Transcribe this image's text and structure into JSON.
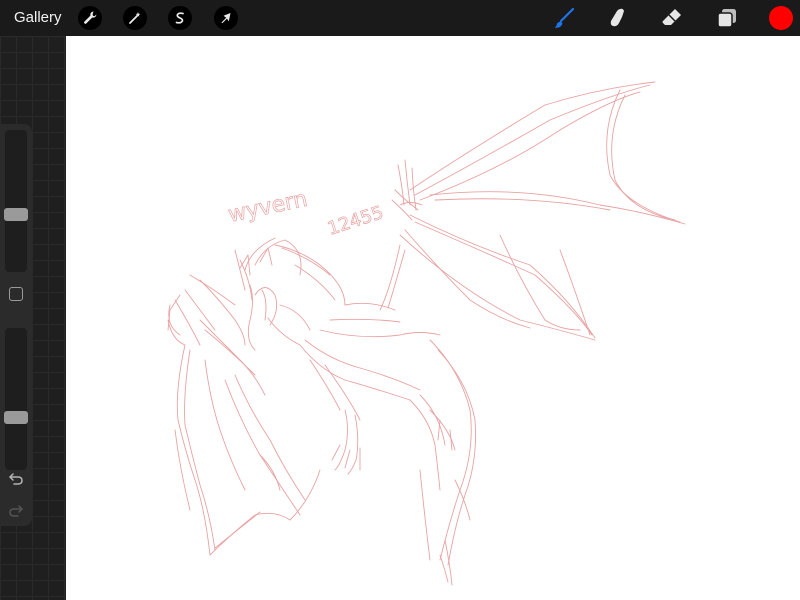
{
  "topbar": {
    "gallery_label": "Gallery",
    "tools": [
      {
        "name": "actions",
        "icon": "wrench-icon"
      },
      {
        "name": "adjustments",
        "icon": "magic-wand-icon"
      },
      {
        "name": "selection",
        "icon": "selection-s-icon"
      },
      {
        "name": "transform",
        "icon": "arrow-cursor-icon"
      }
    ],
    "right_tools": [
      {
        "name": "brush",
        "icon": "brush-icon",
        "active": true
      },
      {
        "name": "smudge",
        "icon": "smudge-finger-icon"
      },
      {
        "name": "eraser",
        "icon": "eraser-icon"
      },
      {
        "name": "layers",
        "icon": "layers-icon"
      }
    ],
    "current_color": "#ff0000",
    "active_tool_color": "#1e74e8"
  },
  "sidebar": {
    "brush_size_level": 0.35,
    "opacity_level": 0.3,
    "modify_icon": "square-icon",
    "undo_icon": "undo-icon",
    "redo_icon": "redo-icon"
  },
  "canvas": {
    "sketch_text": "wyvern",
    "sketch_number": "12455",
    "stroke_color": "#e7a3a3"
  }
}
